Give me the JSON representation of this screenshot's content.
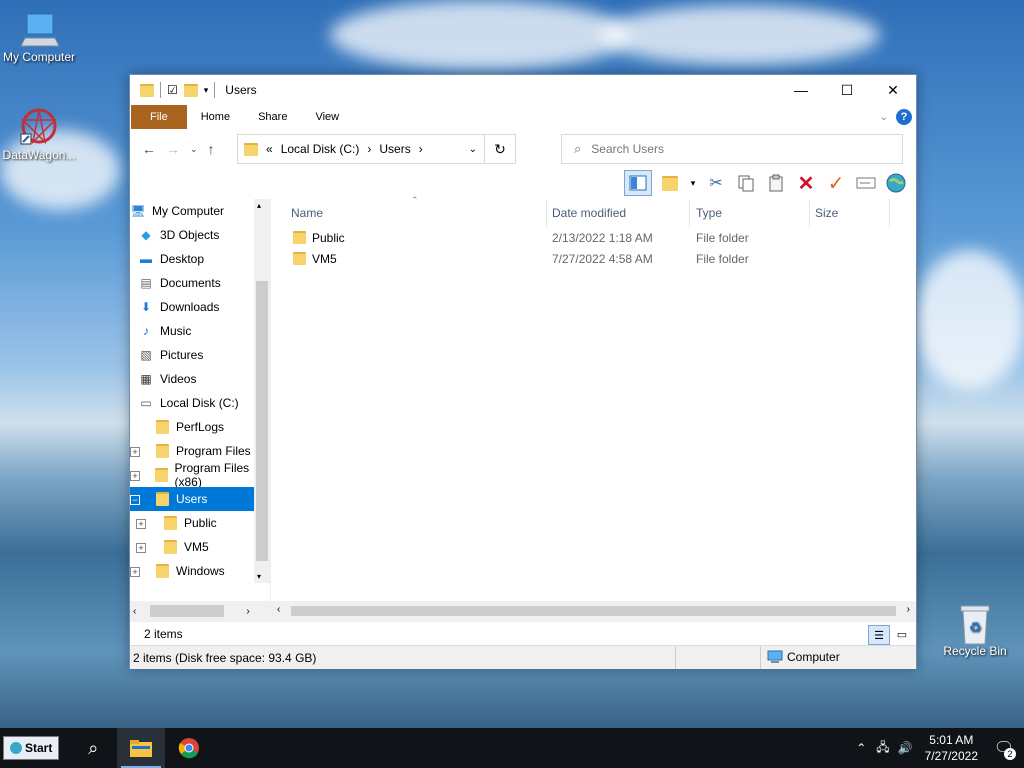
{
  "desktop": {
    "icons": [
      {
        "label": "My Computer"
      },
      {
        "label": "DataWagon..."
      },
      {
        "label": "Recycle Bin"
      }
    ]
  },
  "window": {
    "title": "Users",
    "ribbon_tabs": [
      "File",
      "Home",
      "Share",
      "View"
    ],
    "address": {
      "prefix": "«",
      "crumbs": [
        "Local Disk (C:)",
        "Users"
      ]
    },
    "search_placeholder": "Search Users",
    "nav_pane": [
      {
        "label": "My Computer",
        "icon": "computer-icon"
      },
      {
        "label": "3D Objects",
        "icon": "cube-icon"
      },
      {
        "label": "Desktop",
        "icon": "desktop-icon"
      },
      {
        "label": "Documents",
        "icon": "document-icon"
      },
      {
        "label": "Downloads",
        "icon": "download-icon"
      },
      {
        "label": "Music",
        "icon": "music-icon"
      },
      {
        "label": "Pictures",
        "icon": "picture-icon"
      },
      {
        "label": "Videos",
        "icon": "video-icon"
      },
      {
        "label": "Local Disk (C:)",
        "icon": "drive-icon"
      },
      {
        "label": "PerfLogs",
        "icon": "folder-icon"
      },
      {
        "label": "Program Files",
        "icon": "folder-icon"
      },
      {
        "label": "Program Files (x86)",
        "icon": "folder-icon"
      },
      {
        "label": "Users",
        "icon": "folder-icon"
      },
      {
        "label": "Public",
        "icon": "folder-icon"
      },
      {
        "label": "VM5",
        "icon": "folder-icon"
      },
      {
        "label": "Windows",
        "icon": "folder-icon"
      }
    ],
    "columns": [
      "Name",
      "Date modified",
      "Type",
      "Size"
    ],
    "files": [
      {
        "name": "Public",
        "date": "2/13/2022 1:18 AM",
        "type": "File folder",
        "size": ""
      },
      {
        "name": "VM5",
        "date": "7/27/2022 4:58 AM",
        "type": "File folder",
        "size": ""
      }
    ],
    "item_count": "2 items",
    "status_detail": "2 items (Disk free space: 93.4 GB)",
    "status_location": "Computer"
  },
  "taskbar": {
    "start_label": "Start",
    "time": "5:01 AM",
    "date": "7/27/2022",
    "notification_count": "2"
  },
  "colors": {
    "file_tab": "#a9641d",
    "selection": "#0078d7",
    "folder": "#f6d36b"
  }
}
